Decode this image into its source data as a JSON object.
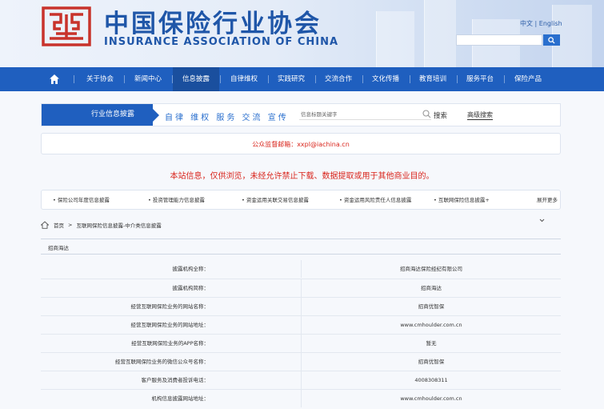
{
  "header": {
    "title_cn": "中国保险行业协会",
    "title_en": "INSURANCE ASSOCIATION OF CHINA",
    "lang_cn": "中文",
    "lang_sep": "|",
    "lang_en": "English"
  },
  "nav": {
    "items": [
      "关于协会",
      "新闻中心",
      "信息披露",
      "自律维权",
      "实践研究",
      "交流合作",
      "文化传播",
      "教育培训",
      "服务平台",
      "保险产品"
    ],
    "active": "信息披露"
  },
  "disclosure": {
    "label": "行业信息披露",
    "slogan": "自律 维权 服务 交流 宣传",
    "search_placeholder": "信息标题关键字",
    "search_label": "搜索",
    "advanced_label": "高级搜索"
  },
  "notice": "公众监督邮箱：xxpl@iachina.cn",
  "warning": "本站信息，仅供浏览，未经允许禁止下载、数据提取或用于其他商业目的。",
  "categories": {
    "items": [
      "• 保险公司年度信息披露",
      "• 投资管理能力信息披露",
      "• 资金运用关联交易信息披露",
      "• 资金运用风险责任人信息披露",
      "• 互联网保险信息披露+"
    ],
    "more": "展开更多"
  },
  "breadcrumb": {
    "home": "首页",
    "sep": ">",
    "current": "互联网保险信息披露-中介类信息披露"
  },
  "section": {
    "name": "招商海达"
  },
  "table": {
    "rows": [
      {
        "k": "披露机构全称：",
        "v": "招商海达保险经纪有限公司"
      },
      {
        "k": "披露机构简称：",
        "v": "招商海达"
      },
      {
        "k": "经营互联网保险业务的网站名称：",
        "v": "招商优智保"
      },
      {
        "k": "经营互联网保险业务的网站地址：",
        "v": "www.cmhoulder.com.cn"
      },
      {
        "k": "经营互联网保险业务的APP名称：",
        "v": "暂无"
      },
      {
        "k": "经营互联网保险业务的微信公众号名称：",
        "v": "招商优智保"
      },
      {
        "k": "客户服务及消费者投诉电话：",
        "v": "4008308311"
      },
      {
        "k": "机构信息披露网站地址：",
        "v": "www.cmhoulder.com.cn"
      }
    ]
  },
  "colors": {
    "primary": "#1f5fbf",
    "brand": "#1f56a8",
    "warning": "#d9251c",
    "logo": "#c8332b"
  },
  "icons": {
    "logo": "association-logo",
    "home": "home-icon",
    "search": "search-icon",
    "chevron": "chevron-down-icon"
  }
}
